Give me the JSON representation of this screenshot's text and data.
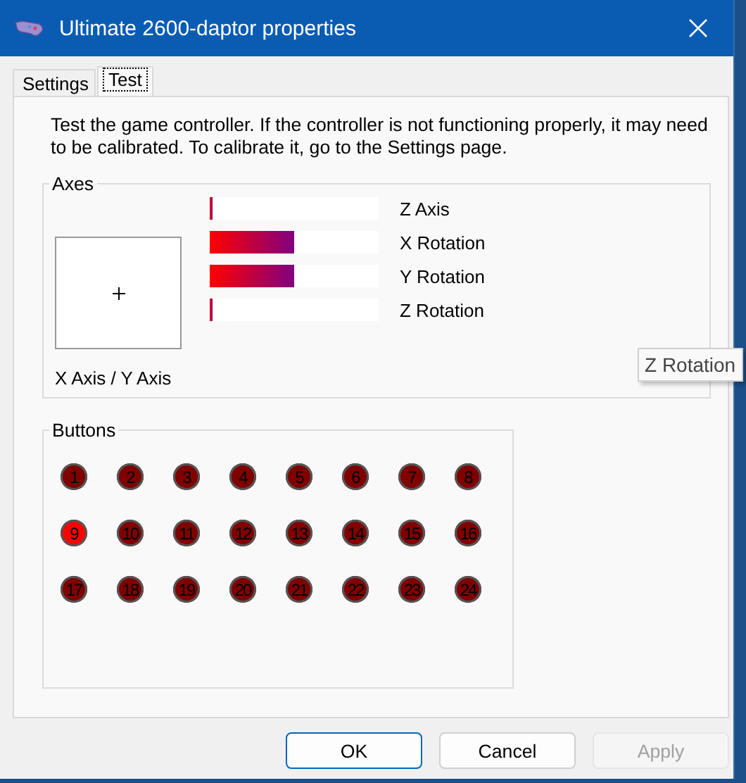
{
  "window": {
    "title": "Ultimate 2600-daptor properties"
  },
  "tabs": [
    {
      "label": "Settings",
      "selected": false
    },
    {
      "label": "Test",
      "selected": true
    }
  ],
  "description": "Test the game controller.  If the controller is not functioning properly, it may need to be calibrated.  To calibrate it, go to the Settings page.",
  "axes": {
    "title": "Axes",
    "xy_label": "X Axis / Y Axis",
    "sliders": [
      {
        "name": "Z Axis",
        "level": 0.02
      },
      {
        "name": "X Rotation",
        "level": 0.5
      },
      {
        "name": "Y Rotation",
        "level": 0.5
      },
      {
        "name": "Z Rotation",
        "level": 0.01
      }
    ]
  },
  "tooltip": "Z Rotation",
  "buttons_group": {
    "title": "Buttons",
    "buttons": [
      {
        "label": "1",
        "pressed": false
      },
      {
        "label": "2",
        "pressed": false
      },
      {
        "label": "3",
        "pressed": false
      },
      {
        "label": "4",
        "pressed": false
      },
      {
        "label": "5",
        "pressed": false
      },
      {
        "label": "6",
        "pressed": false
      },
      {
        "label": "7",
        "pressed": false
      },
      {
        "label": "8",
        "pressed": false
      },
      {
        "label": "9",
        "pressed": true
      },
      {
        "label": "10",
        "pressed": false
      },
      {
        "label": "11",
        "pressed": false
      },
      {
        "label": "12",
        "pressed": false
      },
      {
        "label": "13",
        "pressed": false
      },
      {
        "label": "14",
        "pressed": false
      },
      {
        "label": "15",
        "pressed": false
      },
      {
        "label": "16",
        "pressed": false
      },
      {
        "label": "17",
        "pressed": false
      },
      {
        "label": "18",
        "pressed": false
      },
      {
        "label": "19",
        "pressed": false
      },
      {
        "label": "20",
        "pressed": false
      },
      {
        "label": "21",
        "pressed": false
      },
      {
        "label": "22",
        "pressed": false
      },
      {
        "label": "23",
        "pressed": false
      },
      {
        "label": "24",
        "pressed": false
      }
    ]
  },
  "dialog_buttons": [
    {
      "label": "OK",
      "default": true,
      "disabled": false
    },
    {
      "label": "Cancel",
      "default": false,
      "disabled": false
    },
    {
      "label": "Apply",
      "default": false,
      "disabled": true
    }
  ]
}
